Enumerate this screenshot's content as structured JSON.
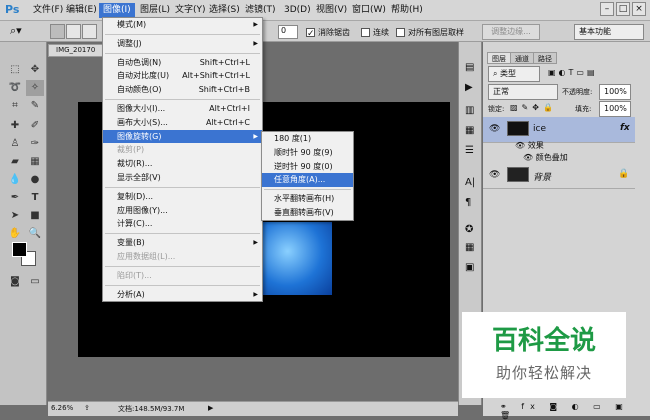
{
  "app": {
    "logo": "Ps"
  },
  "menubar": {
    "items": [
      "文件(F)",
      "编辑(E)",
      "图像(I)",
      "图层(L)",
      "文字(Y)",
      "选择(S)",
      "滤镜(T)",
      "3D(D)",
      "视图(V)",
      "窗口(W)",
      "帮助(H)"
    ],
    "active_index": 2
  },
  "options_bar": {
    "feather_value": "0",
    "antialias_label": "消除锯齿",
    "contiguous_label": "连续",
    "all_layers_label": "对所有图层取样",
    "refine_edge_label": "调整边缘...",
    "workspace": "基本功能"
  },
  "document": {
    "tab_title": "IMG_20170",
    "zoom": "6.26%",
    "doc_size": "文档:148.5M/93.7M"
  },
  "image_menu": {
    "items": [
      {
        "label": "模式(M)",
        "shortcut": "",
        "submenu": true,
        "disabled": false
      },
      {
        "sep": true
      },
      {
        "label": "调整(J)",
        "shortcut": "",
        "submenu": true,
        "disabled": false
      },
      {
        "sep": true
      },
      {
        "label": "自动色调(N)",
        "shortcut": "Shift+Ctrl+L",
        "submenu": false,
        "disabled": false
      },
      {
        "label": "自动对比度(U)",
        "shortcut": "Alt+Shift+Ctrl+L",
        "submenu": false,
        "disabled": false
      },
      {
        "label": "自动颜色(O)",
        "shortcut": "Shift+Ctrl+B",
        "submenu": false,
        "disabled": false
      },
      {
        "sep": true
      },
      {
        "label": "图像大小(I)...",
        "shortcut": "Alt+Ctrl+I",
        "submenu": false,
        "disabled": false
      },
      {
        "label": "画布大小(S)...",
        "shortcut": "Alt+Ctrl+C",
        "submenu": false,
        "disabled": false
      },
      {
        "label": "图像旋转(G)",
        "shortcut": "",
        "submenu": true,
        "disabled": false,
        "highlight": true
      },
      {
        "label": "裁剪(P)",
        "shortcut": "",
        "submenu": false,
        "disabled": true
      },
      {
        "label": "裁切(R)...",
        "shortcut": "",
        "submenu": false,
        "disabled": false
      },
      {
        "label": "显示全部(V)",
        "shortcut": "",
        "submenu": false,
        "disabled": false
      },
      {
        "sep": true
      },
      {
        "label": "复制(D)...",
        "shortcut": "",
        "submenu": false,
        "disabled": false
      },
      {
        "label": "应用图像(Y)...",
        "shortcut": "",
        "submenu": false,
        "disabled": false
      },
      {
        "label": "计算(C)...",
        "shortcut": "",
        "submenu": false,
        "disabled": false
      },
      {
        "sep": true
      },
      {
        "label": "变量(B)",
        "shortcut": "",
        "submenu": true,
        "disabled": false
      },
      {
        "label": "应用数据组(L)...",
        "shortcut": "",
        "submenu": false,
        "disabled": true
      },
      {
        "sep": true
      },
      {
        "label": "陷印(T)...",
        "shortcut": "",
        "submenu": false,
        "disabled": true
      },
      {
        "sep": true
      },
      {
        "label": "分析(A)",
        "shortcut": "",
        "submenu": true,
        "disabled": false
      }
    ]
  },
  "rotate_menu": {
    "items": [
      {
        "label": "180 度(1)"
      },
      {
        "label": "顺时针 90 度(9)"
      },
      {
        "label": "逆时针 90 度(0)"
      },
      {
        "label": "任意角度(A)...",
        "highlight": true
      },
      {
        "sep": true
      },
      {
        "label": "水平翻转画布(H)"
      },
      {
        "label": "垂直翻转画布(V)"
      }
    ]
  },
  "layers_panel": {
    "tabs": [
      "图层",
      "通道",
      "路径"
    ],
    "kind_filter": "类型",
    "blend_mode": "正常",
    "opacity_label": "不透明度:",
    "opacity_value": "100%",
    "lock_label": "锁定:",
    "fill_label": "填充:",
    "fill_value": "100%",
    "layers": [
      {
        "name": "ice",
        "fx": "fx"
      },
      {
        "name": "背景"
      }
    ],
    "effects_label": "效果",
    "effect_name": "颜色叠加"
  },
  "watermark": {
    "title": "百科全说",
    "subtitle": "助你轻松解决"
  },
  "colors": {
    "accent": "#3b74d1",
    "watermark_green": "#1e9a45"
  }
}
